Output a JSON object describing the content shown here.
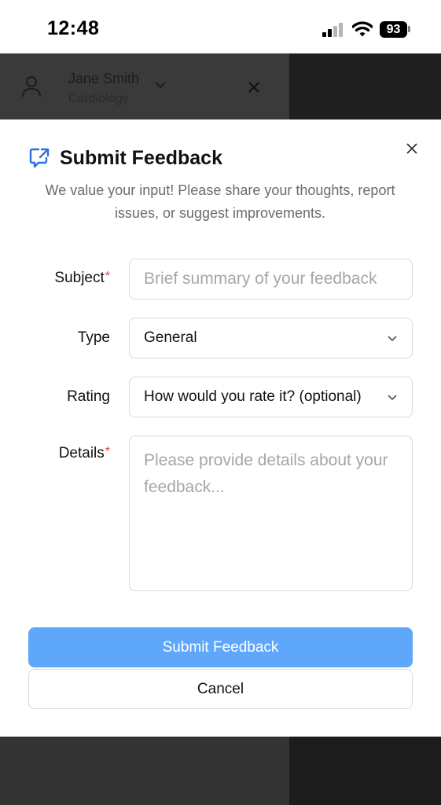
{
  "status_bar": {
    "time": "12:48",
    "battery": "93",
    "icons": [
      "cellular-signal-icon",
      "wifi-icon",
      "battery-icon"
    ]
  },
  "background_app": {
    "user_name": "Jane Smith",
    "department": "Cardiology"
  },
  "modal": {
    "title": "Submit Feedback",
    "description": "We value your input! Please share your thoughts, report issues, or suggest improvements.",
    "fields": {
      "subject": {
        "label": "Subject",
        "required_mark": "*",
        "placeholder": "Brief summary of your feedback",
        "value": ""
      },
      "type": {
        "label": "Type",
        "value": "General"
      },
      "rating": {
        "label": "Rating",
        "value": "How would you rate it? (optional)"
      },
      "details": {
        "label": "Details",
        "required_mark": "*",
        "placeholder": "Please provide details about your feedback...",
        "value": ""
      }
    },
    "submit_label": "Submit Feedback",
    "cancel_label": "Cancel"
  },
  "colors": {
    "accent": "#5ea7fb",
    "title_icon": "#2f6fe0",
    "required": "#e04848",
    "overlay_dark": "#2b2b2b"
  }
}
